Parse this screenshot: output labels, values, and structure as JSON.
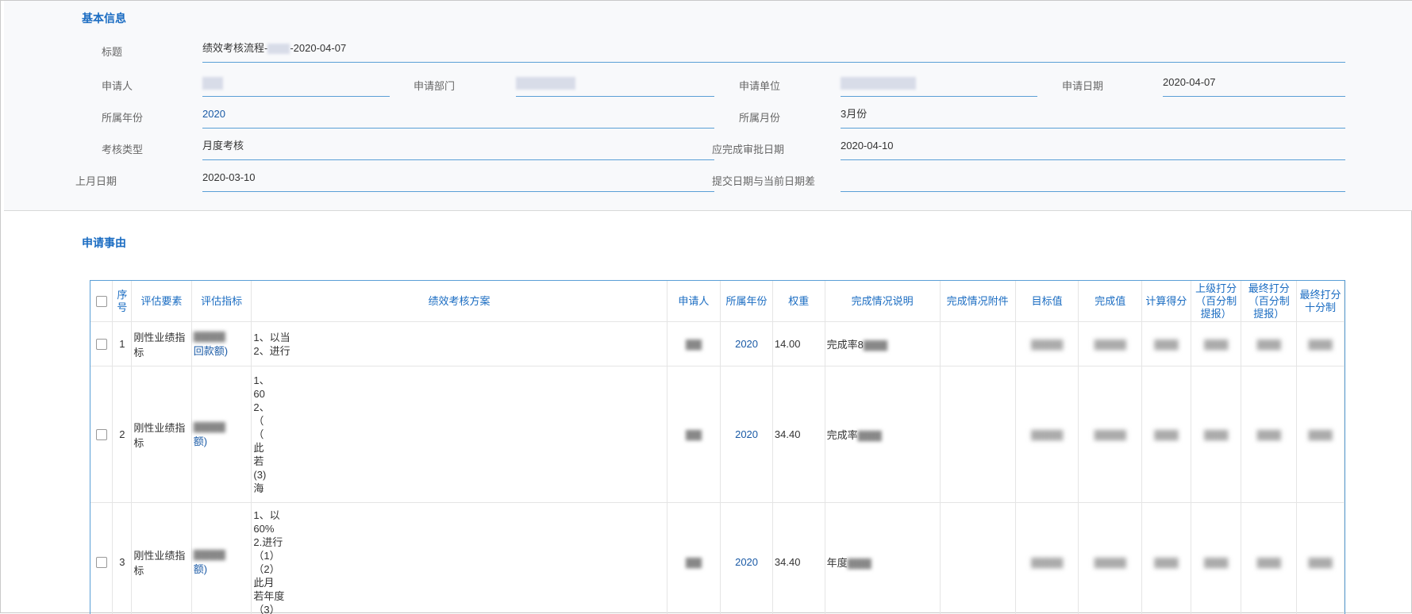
{
  "basic": {
    "title": "基本信息",
    "fields": {
      "subject_label": "标题",
      "subject_value_prefix": "绩效考核流程-",
      "subject_value_suffix": "-2020-04-07",
      "applicant_label": "申请人",
      "dept_label": "申请部门",
      "unit_label": "申请单位",
      "date_label": "申请日期",
      "date_value": "2020-04-07",
      "year_label": "所属年份",
      "year_value": "2020",
      "month_label": "所属月份",
      "month_value": "3月份",
      "type_label": "考核类型",
      "type_value": "月度考核",
      "due_label": "应完成审批日期",
      "due_value": "2020-04-10",
      "lastmonth_label": "上月日期",
      "lastmonth_value": "2020-03-10",
      "diff_label": "提交日期与当前日期差",
      "diff_value": ""
    }
  },
  "reason": {
    "title": "申请事由"
  },
  "table": {
    "headers": [
      "序号",
      "评估要素",
      "评估指标",
      "绩效考核方案",
      "申请人",
      "所属年份",
      "权重",
      "完成情况说明",
      "完成情况附件",
      "目标值",
      "完成值",
      "计算得分",
      "上级打分（百分制提报）",
      "最终打分（百分制提报）",
      "最终打分十分制"
    ],
    "rows": [
      {
        "no": "1",
        "element": "刚性业绩指标",
        "index_tail": "回款额)",
        "plan": [
          "1、以当",
          "2、进行"
        ],
        "year": "2020",
        "weight": "14.00",
        "desc": "完成率8"
      },
      {
        "no": "2",
        "element": "刚性业绩指标",
        "index_tail": "额)",
        "plan": [
          "1、",
          "60",
          "2、",
          "（",
          "（",
          "此",
          "若",
          "(3)",
          "海"
        ],
        "year": "2020",
        "weight": "34.40",
        "desc": "完成率"
      },
      {
        "no": "3",
        "element": "刚性业绩指标",
        "index_tail": "额)",
        "plan": [
          "1、以",
          "60%",
          "2.进行",
          "（1）",
          "（2）",
          "此月",
          "若年度",
          "（3）"
        ],
        "year": "2020",
        "weight": "34.40",
        "desc": "年度"
      }
    ]
  }
}
